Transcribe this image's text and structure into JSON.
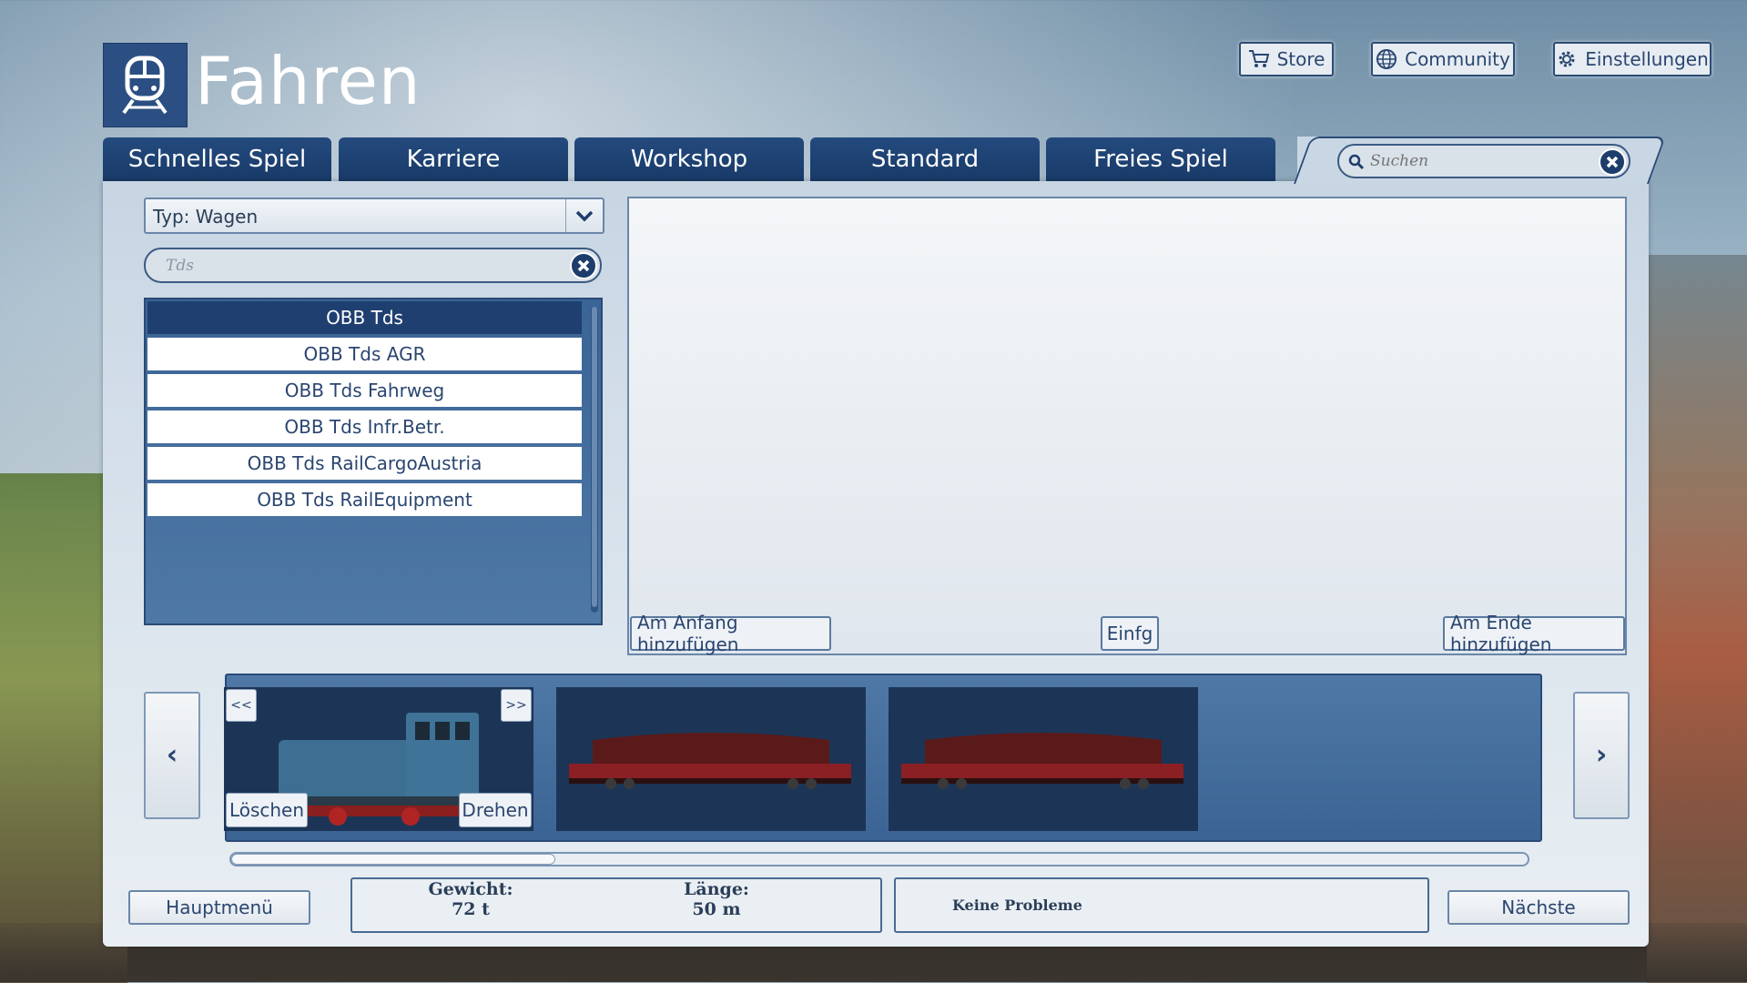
{
  "header": {
    "title": "Fahren",
    "store_label": "Store",
    "community_label": "Community",
    "settings_label": "Einstellungen"
  },
  "tabs": [
    {
      "label": "Schnelles Spiel"
    },
    {
      "label": "Karriere"
    },
    {
      "label": "Workshop"
    },
    {
      "label": "Standard"
    },
    {
      "label": "Freies Spiel"
    }
  ],
  "search": {
    "placeholder": "Suchen"
  },
  "filter": {
    "type_label": "Typ: Wagen",
    "query": "Tds"
  },
  "vehicle_list": [
    {
      "label": "OBB Tds",
      "selected": true
    },
    {
      "label": "OBB Tds AGR",
      "selected": false
    },
    {
      "label": "OBB Tds Fahrweg",
      "selected": false
    },
    {
      "label": "OBB Tds Infr.Betr.",
      "selected": false
    },
    {
      "label": "OBB Tds RailCargoAustria",
      "selected": false
    },
    {
      "label": "OBB Tds RailEquipment",
      "selected": false
    }
  ],
  "preview": {
    "add_start_label": "Am Anfang hinzufügen",
    "insert_label": "Einfg",
    "add_end_label": "Am Ende hinzufügen"
  },
  "consist": {
    "move_left_label": "<<",
    "move_right_label": ">>",
    "delete_label": "Löschen",
    "rotate_label": "Drehen",
    "scroll_position": 0.25
  },
  "footer": {
    "main_menu_label": "Hauptmenü",
    "weight_label": "Gewicht:",
    "weight_value": "72 t",
    "length_label": "Länge:",
    "length_value": "50 m",
    "status": "Keine Probleme",
    "next_label": "Nächste"
  },
  "colors": {
    "accent": "#1f3f70",
    "tab": "#1e4374",
    "panel": "#d3dee8"
  }
}
